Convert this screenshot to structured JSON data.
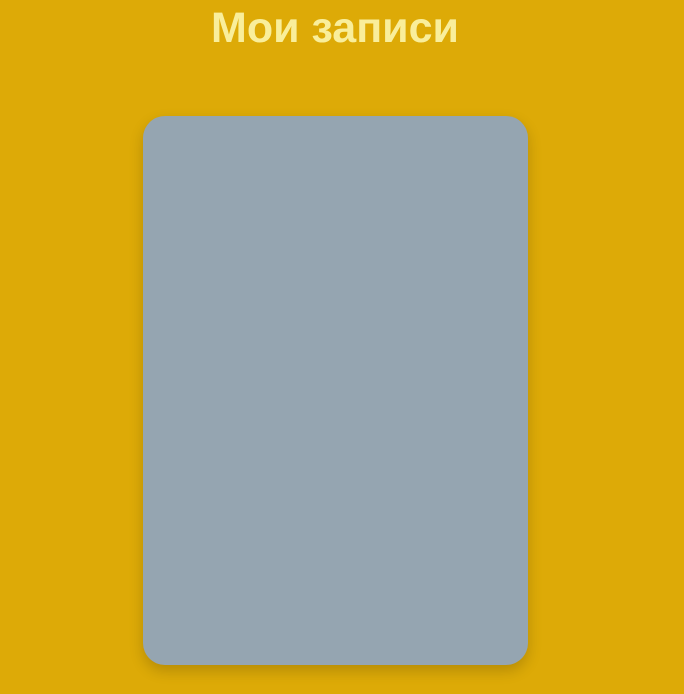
{
  "page": {
    "title": "Мои записи"
  },
  "add_card": {
    "icon": "plus-icon"
  },
  "colors": {
    "background": "#DDAA07",
    "title": "#F9EE9B",
    "card": "#95A5B1",
    "icon_top": "#29D3F0",
    "icon_bottom": "#0E9BE0"
  }
}
